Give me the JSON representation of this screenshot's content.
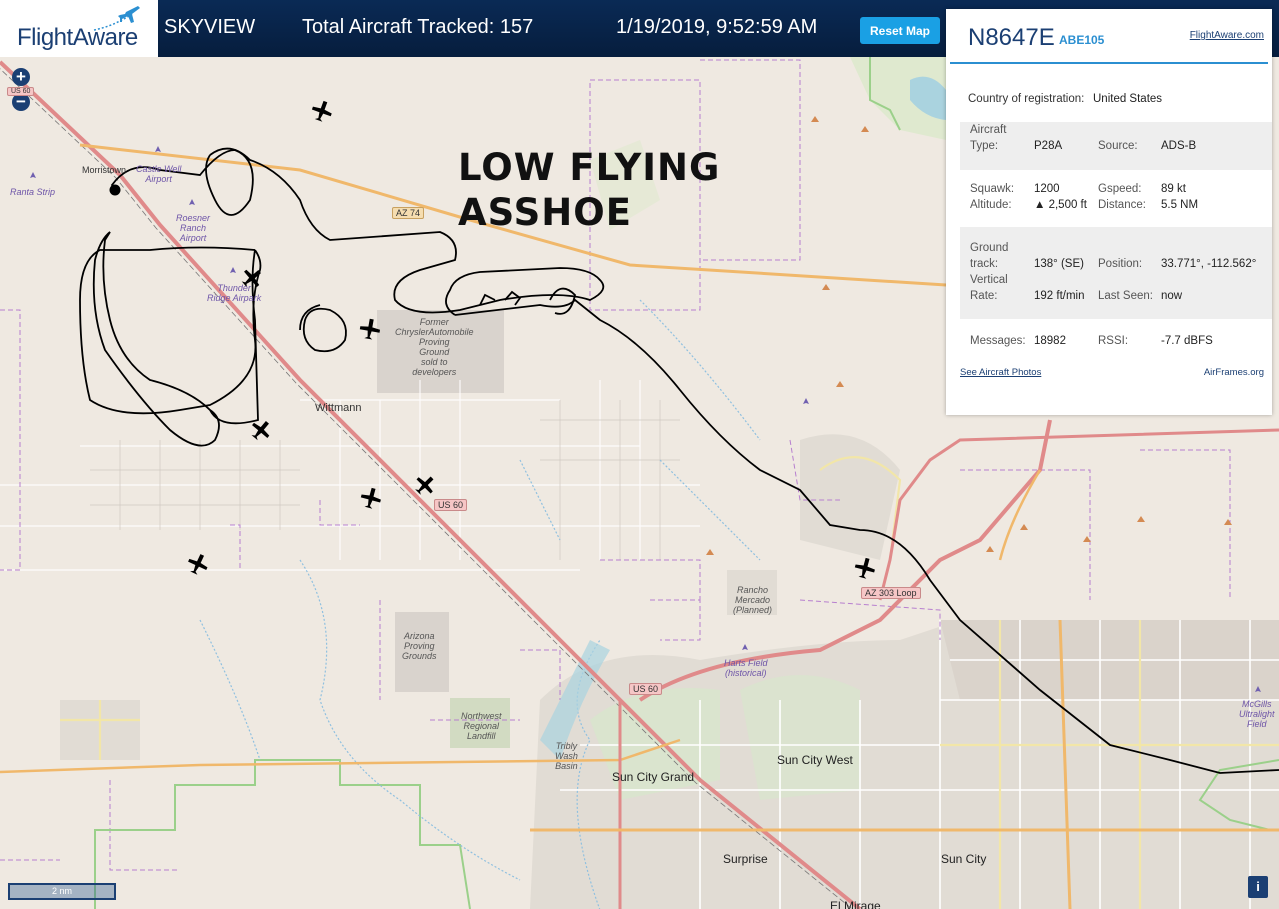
{
  "header": {
    "logo": "FlightAware",
    "app_name": "SKYVIEW",
    "tracked": "Total Aircraft Tracked: 157",
    "datetime": "1/19/2019, 9:52:59 AM",
    "reset_label": "Reset Map"
  },
  "map": {
    "zoom_in": "+",
    "zoom_out": "−",
    "overlay_text": [
      "LOW FLYING",
      "ASSHOE"
    ],
    "places": {
      "morristown": "Morristown",
      "wittmann": "Wittmann",
      "sun_city_grand": "Sun City Grand",
      "sun_city_west": "Sun City West",
      "surprise": "Surprise",
      "sun_city": "Sun City",
      "el_mirage": "El Mirage"
    },
    "airports": {
      "ranta": "Ranta Strip",
      "castle_well": [
        "Castle Well",
        "Airport"
      ],
      "roesner": [
        "Roesner",
        "Ranch",
        "Airport"
      ],
      "thunder": [
        "Thunder",
        "Ridge Airpark"
      ],
      "harts": [
        "Harts Field",
        "(historical)"
      ],
      "mcgills": [
        "McGills",
        "Ultralight",
        "Field"
      ]
    },
    "notes": {
      "chrysler": [
        "Former",
        "ChryslerAutomobile",
        "Proving",
        "Ground",
        "sold to",
        "developers"
      ],
      "arizona_pg": [
        "Arizona",
        "Proving",
        "Grounds"
      ],
      "landfill": [
        "Northwest",
        "Regional",
        "Landfill"
      ],
      "rancho": [
        "Rancho",
        "Mercado",
        "(Planned)"
      ],
      "tribly": [
        "Tribly",
        "Wash",
        "Basin"
      ]
    },
    "shields": {
      "us60_nw": "US 60",
      "az74": "AZ 74",
      "us60_mid": "US 60",
      "us60_south": "US 60",
      "az303": "AZ 303 Loop"
    },
    "scale_label": "2 nm",
    "info_label": "i"
  },
  "panel": {
    "ident": "N8647E",
    "callsign": "ABE105",
    "link": "FlightAware.com",
    "country_label": "Country of registration:",
    "country_value": "United States",
    "aircraft_type_label": [
      "Aircraft",
      "Type:"
    ],
    "aircraft_type_value": "P28A",
    "source_label": "Source:",
    "source_value": "ADS-B",
    "squawk_label": "Squawk:",
    "squawk_value": "1200",
    "gspeed_label": "Gspeed:",
    "gspeed_value": "89 kt",
    "altitude_label": "Altitude:",
    "altitude_value": "▲ 2,500 ft",
    "distance_label": "Distance:",
    "distance_value": "5.5 NM",
    "ground_track_label": [
      "Ground",
      "track:"
    ],
    "ground_track_value": "138° (SE)",
    "position_label": "Position:",
    "position_value": "33.771°, -112.562°",
    "vertical_rate_label": [
      "Vertical",
      "Rate:"
    ],
    "vertical_rate_value": "192 ft/min",
    "last_seen_label": "Last Seen:",
    "last_seen_value": "now",
    "messages_label": "Messages:",
    "messages_value": "18982",
    "rssi_label": "RSSI:",
    "rssi_value": "-7.7 dBFS",
    "photos_link": "See Aircraft Photos",
    "airframes_link": "AirFrames.org"
  },
  "colors": {
    "header_bg": "#061d3d",
    "accent": "#1aa0e4",
    "brand": "#1b3f73",
    "track": "#000000"
  }
}
